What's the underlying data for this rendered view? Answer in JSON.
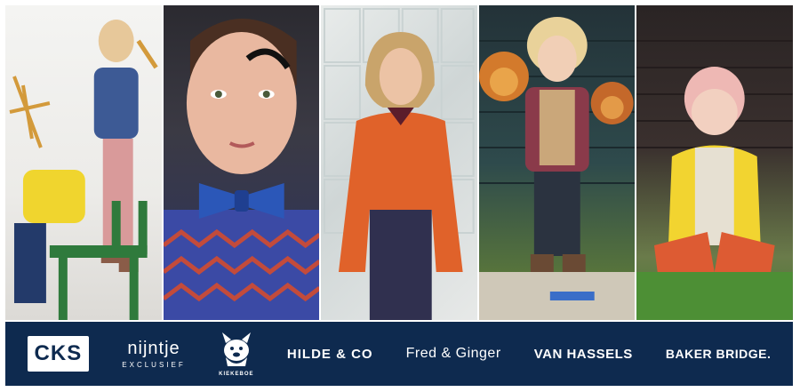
{
  "photos": [
    {
      "icon": "girl-on-green-chair-photo"
    },
    {
      "icon": "boy-with-bow-tie-photo"
    },
    {
      "icon": "girl-in-orange-sweater-photo"
    },
    {
      "icon": "boy-with-lion-masks-photo"
    },
    {
      "icon": "baby-in-yellow-cardigan-photo"
    }
  ],
  "brands": {
    "cks": "CKS",
    "nijntje_main": "nijntje",
    "nijntje_sub": "EXCLUSIEF",
    "kiekeboe": "KIEKEBOE",
    "hilde": "HILDE & CO",
    "fred": "Fred & Ginger",
    "vanhassels": "VAN HASSELS",
    "baker": "BAKER BRIDGE."
  },
  "colors": {
    "brand_bar": "#0e2a4f",
    "text": "#ffffff"
  }
}
